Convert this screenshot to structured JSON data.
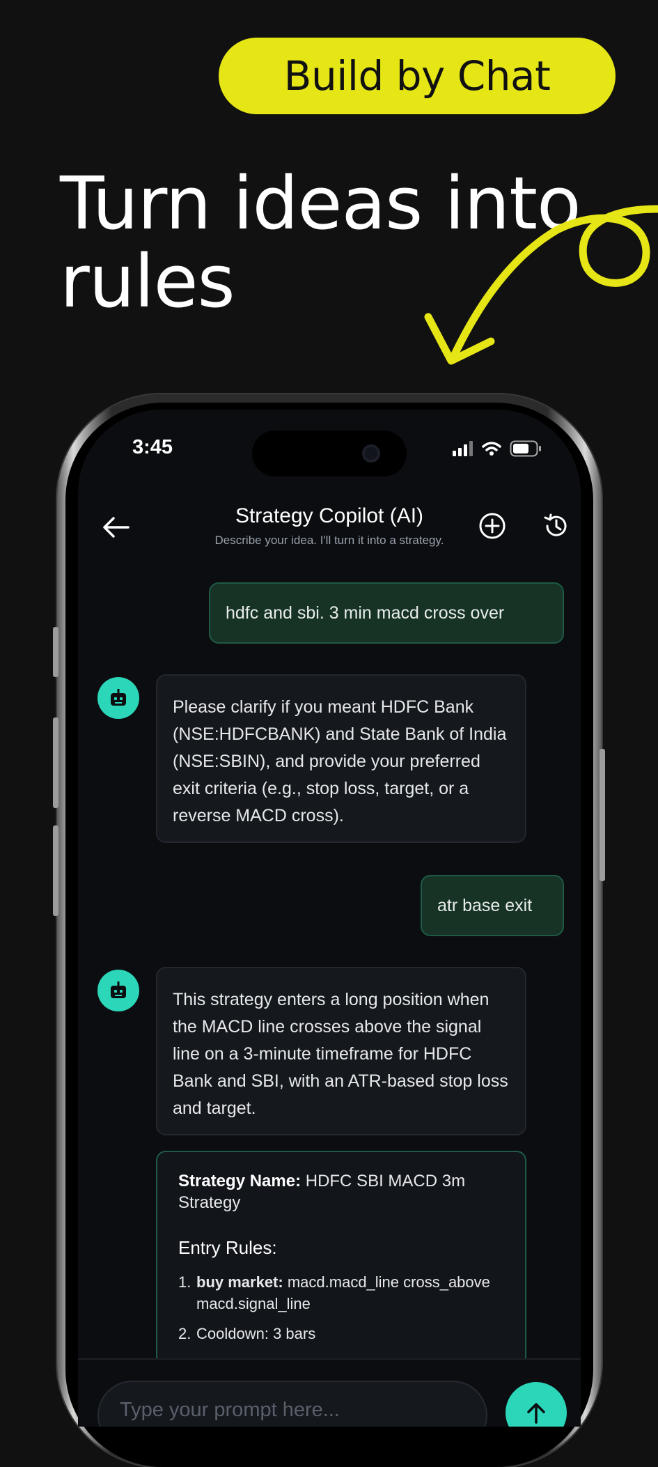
{
  "promo": {
    "badge": "Build by Chat",
    "headline_line1": "Turn ideas into",
    "headline_line2": "rules",
    "accent_color": "#e6e617"
  },
  "status_bar": {
    "time": "3:45"
  },
  "header": {
    "title": "Strategy Copilot (AI)",
    "subtitle": "Describe your idea. I'll turn it into a strategy."
  },
  "messages": [
    {
      "role": "user",
      "text": "hdfc and sbi. 3 min macd cross over"
    },
    {
      "role": "bot",
      "text": "Please clarify if you meant HDFC Bank (NSE:HDFCBANK) and State Bank of India (NSE:SBIN), and provide your preferred exit criteria (e.g., stop loss, target, or a reverse MACD cross)."
    },
    {
      "role": "user",
      "text": "atr base exit"
    },
    {
      "role": "bot",
      "text": "This strategy enters a long position when the MACD line crosses above the signal line on a 3-minute timeframe for HDFC Bank and SBI, with an ATR-based stop loss and target."
    }
  ],
  "strategy_card": {
    "name_label": "Strategy Name:",
    "name_value": "HDFC SBI MACD 3m Strategy",
    "entry_heading": "Entry Rules:",
    "rules": [
      {
        "num": "1.",
        "bold": "buy market:",
        "text": "macd.macd_line cross_above macd.signal_line"
      },
      {
        "num": "2.",
        "bold": "",
        "text": "Cooldown: 3 bars"
      }
    ]
  },
  "composer": {
    "placeholder": "Type your prompt here..."
  },
  "colors": {
    "user_bubble": "#163326",
    "bot_avatar": "#2bd6b9",
    "send_button": "#2bd6b9"
  }
}
